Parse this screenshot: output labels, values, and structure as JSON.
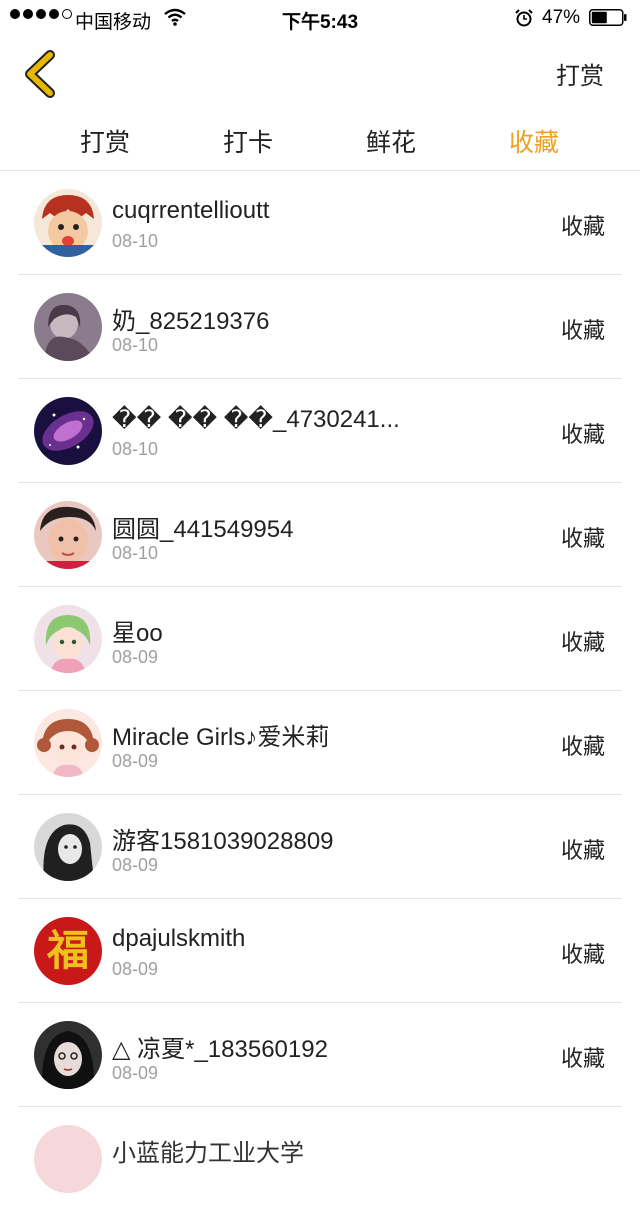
{
  "status": {
    "carrier": "中国移动",
    "time": "下午5:43",
    "battery": "47%"
  },
  "nav": {
    "right_label": "打赏"
  },
  "tabs": [
    {
      "label": "打赏",
      "active": false
    },
    {
      "label": "打卡",
      "active": false
    },
    {
      "label": "鲜花",
      "active": false
    },
    {
      "label": "收藏",
      "active": true
    }
  ],
  "colors": {
    "accent": "#f0a020",
    "back_icon": "#e8b800"
  },
  "items": [
    {
      "name": "cuqrrentellioutt",
      "date": "08-10",
      "action": "收藏",
      "avatar": "cartoon-boy"
    },
    {
      "name": "奶_825219376",
      "date": "08-10",
      "action": "收藏",
      "avatar": "girl-dim"
    },
    {
      "name": "�� �� ��_4730241...",
      "date": "08-10",
      "action": "收藏",
      "avatar": "galaxy"
    },
    {
      "name": "圆圆_441549954",
      "date": "08-10",
      "action": "收藏",
      "avatar": "child"
    },
    {
      "name": "星oo",
      "date": "08-09",
      "action": "收藏",
      "avatar": "anime-green"
    },
    {
      "name": "Miracle Girls♪爱米莉",
      "date": "08-09",
      "action": "收藏",
      "avatar": "anime-pink"
    },
    {
      "name": "游客1581039028809",
      "date": "08-09",
      "action": "收藏",
      "avatar": "girl-bw"
    },
    {
      "name": "dpajulskmith",
      "date": "08-09",
      "action": "收藏",
      "avatar": "fu"
    },
    {
      "name": "△ 凉夏*_183560192",
      "date": "08-09",
      "action": "收藏",
      "avatar": "girl-dark"
    },
    {
      "name": "小蓝能力工业大学",
      "date": "",
      "action": "",
      "avatar": "pink"
    }
  ]
}
